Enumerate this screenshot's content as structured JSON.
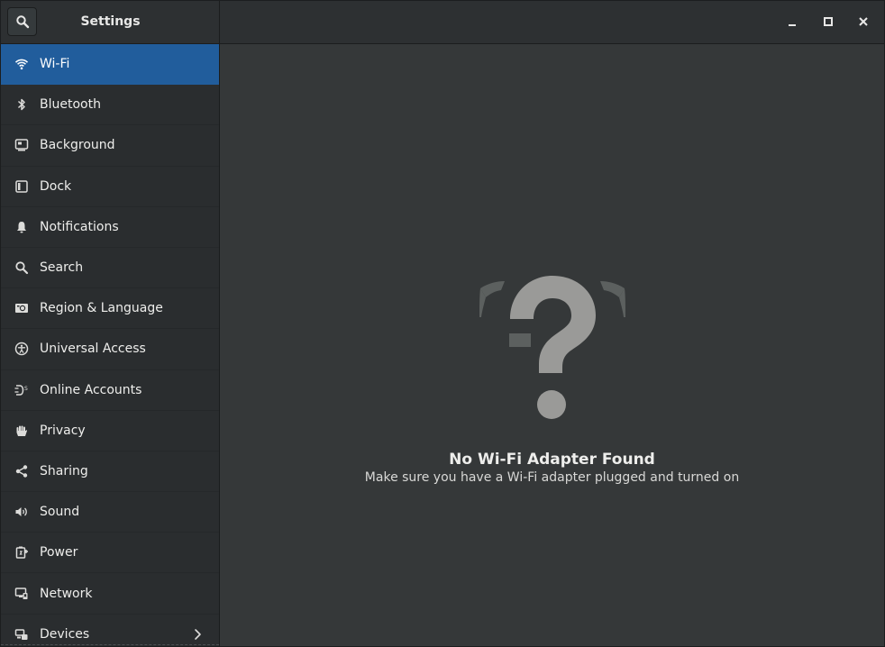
{
  "header": {
    "title": "Settings"
  },
  "sidebar": {
    "items": [
      {
        "label": "Wi-Fi",
        "icon": "wifi-icon",
        "selected": true
      },
      {
        "label": "Bluetooth",
        "icon": "bluetooth-icon"
      },
      {
        "label": "Background",
        "icon": "background-icon"
      },
      {
        "label": "Dock",
        "icon": "dock-icon"
      },
      {
        "label": "Notifications",
        "icon": "bell-icon"
      },
      {
        "label": "Search",
        "icon": "search-icon"
      },
      {
        "label": "Region & Language",
        "icon": "region-icon"
      },
      {
        "label": "Universal Access",
        "icon": "accessibility-icon"
      },
      {
        "label": "Online Accounts",
        "icon": "online-accounts-icon"
      },
      {
        "label": "Privacy",
        "icon": "hand-icon"
      },
      {
        "label": "Sharing",
        "icon": "share-icon"
      },
      {
        "label": "Sound",
        "icon": "speaker-icon"
      },
      {
        "label": "Power",
        "icon": "power-icon"
      },
      {
        "label": "Network",
        "icon": "network-icon"
      },
      {
        "label": "Devices",
        "icon": "devices-icon",
        "has_submenu": true
      }
    ]
  },
  "content": {
    "empty_title": "No Wi-Fi Adapter Found",
    "empty_subtitle": "Make sure you have a Wi-Fi adapter plugged and turned on",
    "empty_icon": "question-mark-icon"
  },
  "colors": {
    "accent": "#215d9c",
    "sidebar_bg": "#2a2d2f",
    "content_bg": "#353839",
    "header_bg": "#2d3032"
  }
}
